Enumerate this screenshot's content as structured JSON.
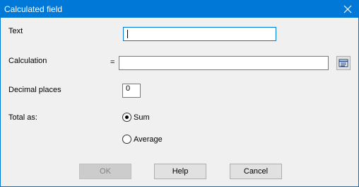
{
  "window": {
    "title": "Calculated field"
  },
  "form": {
    "text_label": "Text",
    "text_value": "",
    "calculation_label": "Calculation",
    "equals_sign": "=",
    "calculation_value": "",
    "decimal_places_label": "Decimal places",
    "decimal_places_value": "0",
    "total_as_label": "Total as:",
    "total_as_options": [
      {
        "label": "Sum",
        "selected": true
      },
      {
        "label": "Average",
        "selected": false
      }
    ]
  },
  "buttons": {
    "ok": "OK",
    "help": "Help",
    "cancel": "Cancel"
  },
  "icons": {
    "close": "close-icon",
    "field_picker": "field-list-icon"
  },
  "colors": {
    "titlebar": "#0078d7",
    "dialog_bg": "#f0f0f0",
    "focus_border": "#0078d7"
  }
}
